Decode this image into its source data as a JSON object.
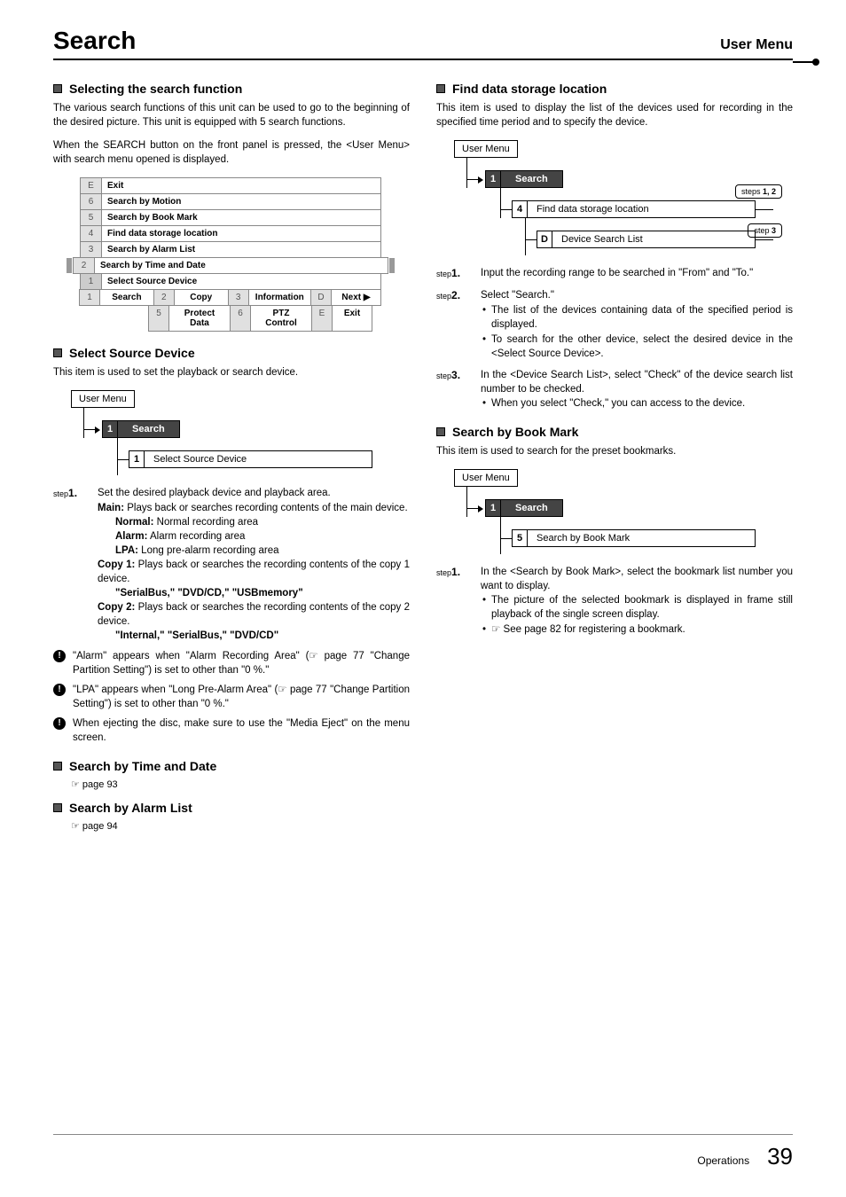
{
  "header": {
    "title": "Search",
    "section": "User Menu"
  },
  "left": {
    "h1": "Selecting the search function",
    "p1": "The various search functions of this unit can be used to go to the beginning of the desired picture. This unit is equipped with 5 search functions.",
    "p2": "When the SEARCH button on the front panel is pressed, the <User Menu> with search menu opened is displayed.",
    "menu": {
      "rows": [
        {
          "k": "E",
          "l": "Exit"
        },
        {
          "k": "6",
          "l": "Search by Motion"
        },
        {
          "k": "5",
          "l": "Search by Book Mark"
        },
        {
          "k": "4",
          "l": "Find data storage location"
        },
        {
          "k": "3",
          "l": "Search by Alarm List"
        },
        {
          "k": "2",
          "l": "Search by Time and Date"
        },
        {
          "k": "1",
          "l": "Select Source Device"
        }
      ],
      "bottom1": [
        {
          "k": "1",
          "l": "Search"
        },
        {
          "k": "2",
          "l": "Copy"
        },
        {
          "k": "3",
          "l": "Information"
        },
        {
          "k": "D",
          "l": "Next ▶"
        }
      ],
      "bottom2": [
        {
          "k": "5",
          "l": "Protect Data"
        },
        {
          "k": "6",
          "l": "PTZ Control"
        },
        {
          "k": "E",
          "l": "Exit"
        }
      ]
    },
    "h2": "Select Source Device",
    "p3": "This item is used to set the playback or search device.",
    "tree1": {
      "root": "User Menu",
      "l1_num": "1",
      "l1_text": "Search",
      "l2_num": "1",
      "l2_text": "Select Source Device"
    },
    "step1": {
      "label": "step",
      "n": "1.",
      "text1": "Set the desired playback device and playback area.",
      "main_b": "Main:",
      "main_t": " Plays back or searches recording contents of the main device.",
      "normal_b": "Normal:",
      "normal_t": " Normal recording area",
      "alarm_b": "Alarm:",
      "alarm_t": " Alarm recording area",
      "lpa_b": "LPA:",
      "lpa_t": " Long pre-alarm recording area",
      "copy1_b": "Copy 1:",
      "copy1_t": " Plays back or searches the recording contents of the copy 1 device.",
      "copy1_q": "\"SerialBus,\" \"DVD/CD,\" \"USBmemory\"",
      "copy2_b": "Copy 2:",
      "copy2_t": " Plays back or searches the recording contents of the copy 2 device.",
      "copy2_q": "\"Internal,\" \"SerialBus,\" \"DVD/CD\""
    },
    "notes": [
      "\"Alarm\" appears when \"Alarm Recording Area\" (☞ page 77 \"Change Partition Setting\") is set to other than \"0 %.\"",
      "\"LPA\" appears when \"Long Pre-Alarm Area\" (☞ page 77 \"Change Partition Setting\") is set to other than \"0 %.\"",
      "When ejecting the disc, make sure to use the \"Media Eject\" on the menu screen."
    ],
    "h3": "Search by Time and Date",
    "p4": "☞ page 93",
    "h4": "Search by Alarm List",
    "p5": "☞ page 94"
  },
  "right": {
    "h1": "Find data storage location",
    "p1": "This item is used to display the list of the devices used for recording in the specified time period and to specify the device.",
    "tree": {
      "root": "User Menu",
      "l1_num": "1",
      "l1_text": "Search",
      "l2_num": "4",
      "l2_text": "Find data storage location",
      "l3_num": "D",
      "l3_text": "Device Search List"
    },
    "annot1": "steps 1, 2",
    "annot2": "step 3",
    "steps": [
      {
        "label": "step",
        "n": "1.",
        "text": "Input the recording range to be searched in \"From\" and \"To.\""
      },
      {
        "label": "step",
        "n": "2.",
        "text": "Select \"Search.\"",
        "subs": [
          "The list of the devices containing data of the specified period is displayed.",
          "To search for the other device, select the desired device in the <Select Source Device>."
        ]
      },
      {
        "label": "step",
        "n": "3.",
        "text": "In the <Device Search List>, select \"Check\" of the device search list number to be checked.",
        "subs": [
          "When you select \"Check,\" you can access to the device."
        ]
      }
    ],
    "h2": "Search by Book Mark",
    "p2": "This item is used to search for the preset bookmarks.",
    "tree2": {
      "root": "User Menu",
      "l1_num": "1",
      "l1_text": "Search",
      "l2_num": "5",
      "l2_text": "Search by Book Mark"
    },
    "step_bm": {
      "label": "step",
      "n": "1.",
      "text": "In the <Search by Book Mark>, select the bookmark list number you want to display.",
      "subs": [
        "The picture of the selected bookmark is displayed in frame still playback of the single screen display.",
        "☞ See page 82 for registering a bookmark."
      ]
    }
  },
  "footer": {
    "ops": "Operations",
    "page": "39"
  }
}
